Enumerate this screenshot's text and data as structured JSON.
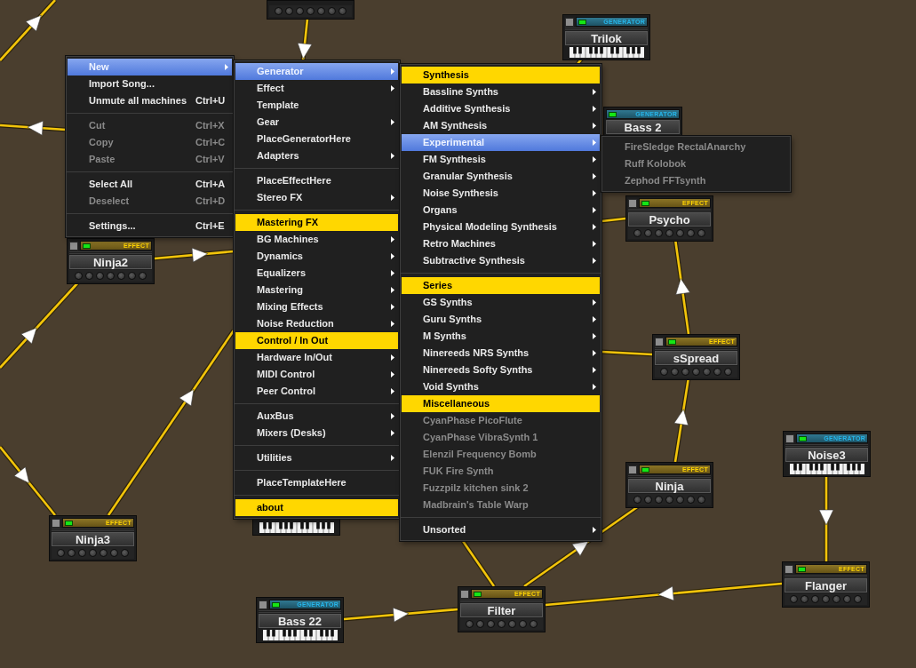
{
  "machines": [
    {
      "kind": "effect"
    },
    {
      "kind": "generator",
      "type_label": "GENERATOR",
      "name": "Trilok"
    },
    {
      "kind": "generator",
      "type_label": "GENERATOR",
      "name": "Bass 2"
    },
    {
      "kind": "effect",
      "type_label": "EFFECT",
      "name": "Psycho"
    },
    {
      "kind": "effect",
      "type_label": "EFFECT",
      "name": "Ninja2"
    },
    {
      "kind": "effect",
      "type_label": "EFFECT",
      "name": "sSpread"
    },
    {
      "kind": "generator",
      "type_label": "GENERATOR",
      "name": "Noise3"
    },
    {
      "kind": "effect",
      "type_label": "EFFECT",
      "name": "Ninja"
    },
    {
      "kind": "effect",
      "type_label": "EFFECT",
      "name": "Ninja3"
    },
    {
      "kind": "generator"
    },
    {
      "kind": "effect",
      "type_label": "EFFECT",
      "name": "Flanger"
    },
    {
      "kind": "effect",
      "type_label": "EFFECT",
      "name": "Filter"
    },
    {
      "kind": "generator",
      "type_label": "GENERATOR",
      "name": "Bass 22"
    }
  ],
  "context_menu": {
    "items": [
      {
        "kind": "submenu",
        "label": "New",
        "selected": true,
        "disabled": false
      },
      {
        "kind": "command",
        "label": "Import Song...",
        "selected": false,
        "disabled": false
      },
      {
        "kind": "command",
        "label": "Unmute all machines",
        "shortcut": "Ctrl+U",
        "selected": false,
        "disabled": false
      },
      {
        "kind": "separator"
      },
      {
        "kind": "command",
        "label": "Cut",
        "shortcut": "Ctrl+X",
        "selected": false,
        "disabled": true
      },
      {
        "kind": "command",
        "label": "Copy",
        "shortcut": "Ctrl+C",
        "selected": false,
        "disabled": true
      },
      {
        "kind": "command",
        "label": "Paste",
        "shortcut": "Ctrl+V",
        "selected": false,
        "disabled": true
      },
      {
        "kind": "separator"
      },
      {
        "kind": "command",
        "label": "Select All",
        "shortcut": "Ctrl+A",
        "selected": false,
        "disabled": false
      },
      {
        "kind": "command",
        "label": "Deselect",
        "shortcut": "Ctrl+D",
        "selected": false,
        "disabled": true
      },
      {
        "kind": "separator"
      },
      {
        "kind": "command",
        "label": "Settings...",
        "shortcut": "Ctrl+E",
        "selected": false,
        "disabled": false
      }
    ]
  },
  "submenus": [
    {
      "items": [
        {
          "kind": "submenu",
          "label": "Generator",
          "selected": true,
          "disabled": false
        },
        {
          "kind": "submenu",
          "label": "Effect",
          "selected": false,
          "disabled": false
        },
        {
          "kind": "command",
          "label": "Template",
          "selected": false,
          "disabled": false
        },
        {
          "kind": "submenu",
          "label": "Gear",
          "selected": false,
          "disabled": false
        },
        {
          "kind": "command",
          "label": "PlaceGeneratorHere",
          "selected": false,
          "disabled": false
        },
        {
          "kind": "submenu",
          "label": "Adapters",
          "selected": false,
          "disabled": false
        },
        {
          "kind": "separator"
        },
        {
          "kind": "command",
          "label": "PlaceEffectHere",
          "selected": false,
          "disabled": false
        },
        {
          "kind": "submenu",
          "label": "Stereo FX",
          "selected": false,
          "disabled": false
        },
        {
          "kind": "separator"
        },
        {
          "kind": "header",
          "label": "Mastering FX"
        },
        {
          "kind": "submenu",
          "label": "BG Machines",
          "selected": false,
          "disabled": false
        },
        {
          "kind": "submenu",
          "label": "Dynamics",
          "selected": false,
          "disabled": false
        },
        {
          "kind": "submenu",
          "label": "Equalizers",
          "selected": false,
          "disabled": false
        },
        {
          "kind": "submenu",
          "label": "Mastering",
          "selected": false,
          "disabled": false
        },
        {
          "kind": "submenu",
          "label": "Mixing Effects",
          "selected": false,
          "disabled": false
        },
        {
          "kind": "submenu",
          "label": "Noise Reduction",
          "selected": false,
          "disabled": false
        },
        {
          "kind": "header",
          "label": "Control / In Out"
        },
        {
          "kind": "submenu",
          "label": "Hardware In/Out",
          "selected": false,
          "disabled": false
        },
        {
          "kind": "submenu",
          "label": "MIDI Control",
          "selected": false,
          "disabled": false
        },
        {
          "kind": "submenu",
          "label": "Peer Control",
          "selected": false,
          "disabled": false
        },
        {
          "kind": "separator"
        },
        {
          "kind": "submenu",
          "label": "AuxBus",
          "selected": false,
          "disabled": false
        },
        {
          "kind": "submenu",
          "label": "Mixers (Desks)",
          "selected": false,
          "disabled": false
        },
        {
          "kind": "separator"
        },
        {
          "kind": "submenu",
          "label": "Utilities",
          "selected": false,
          "disabled": false
        },
        {
          "kind": "separator"
        },
        {
          "kind": "command",
          "label": "PlaceTemplateHere",
          "selected": false,
          "disabled": false
        },
        {
          "kind": "separator"
        },
        {
          "kind": "header",
          "label": "about"
        }
      ]
    },
    {
      "items": [
        {
          "kind": "header",
          "label": "Synthesis"
        },
        {
          "kind": "submenu",
          "label": "Bassline Synths",
          "selected": false,
          "disabled": false
        },
        {
          "kind": "submenu",
          "label": "Additive Synthesis",
          "selected": false,
          "disabled": false
        },
        {
          "kind": "submenu",
          "label": "AM Synthesis",
          "selected": false,
          "disabled": false
        },
        {
          "kind": "submenu",
          "label": "Experimental",
          "selected": true,
          "disabled": false
        },
        {
          "kind": "submenu",
          "label": "FM Synthesis",
          "selected": false,
          "disabled": false
        },
        {
          "kind": "submenu",
          "label": "Granular Synthesis",
          "selected": false,
          "disabled": false
        },
        {
          "kind": "submenu",
          "label": "Noise Synthesis",
          "selected": false,
          "disabled": false
        },
        {
          "kind": "submenu",
          "label": "Organs",
          "selected": false,
          "disabled": false
        },
        {
          "kind": "submenu",
          "label": "Physical Modeling Synthesis",
          "selected": false,
          "disabled": false
        },
        {
          "kind": "submenu",
          "label": "Retro Machines",
          "selected": false,
          "disabled": false
        },
        {
          "kind": "submenu",
          "label": "Subtractive Synthesis",
          "selected": false,
          "disabled": false
        },
        {
          "kind": "separator"
        },
        {
          "kind": "header",
          "label": "Series"
        },
        {
          "kind": "submenu",
          "label": "GS Synths",
          "selected": false,
          "disabled": false
        },
        {
          "kind": "submenu",
          "label": "Guru Synths",
          "selected": false,
          "disabled": false
        },
        {
          "kind": "submenu",
          "label": "M Synths",
          "selected": false,
          "disabled": false
        },
        {
          "kind": "submenu",
          "label": "Ninereeds NRS Synths",
          "selected": false,
          "disabled": false
        },
        {
          "kind": "submenu",
          "label": "Ninereeds Softy Synths",
          "selected": false,
          "disabled": false
        },
        {
          "kind": "submenu",
          "label": "Void Synths",
          "selected": false,
          "disabled": false
        },
        {
          "kind": "header",
          "label": "Miscellaneous"
        },
        {
          "kind": "command",
          "label": "CyanPhase PicoFlute",
          "selected": false,
          "disabled": true
        },
        {
          "kind": "command",
          "label": "CyanPhase VibraSynth 1",
          "selected": false,
          "disabled": true
        },
        {
          "kind": "command",
          "label": "Elenzil Frequency Bomb",
          "selected": false,
          "disabled": true
        },
        {
          "kind": "command",
          "label": "FUK Fire Synth",
          "selected": false,
          "disabled": true
        },
        {
          "kind": "command",
          "label": "Fuzzpilz kitchen sink 2",
          "selected": false,
          "disabled": true
        },
        {
          "kind": "command",
          "label": "Madbrain's Table Warp",
          "selected": false,
          "disabled": true
        },
        {
          "kind": "separator"
        },
        {
          "kind": "submenu",
          "label": "Unsorted",
          "selected": false,
          "disabled": false
        }
      ]
    },
    {
      "items": [
        {
          "kind": "command",
          "label": "FireSledge RectalAnarchy",
          "selected": false,
          "disabled": true
        },
        {
          "kind": "command",
          "label": "Ruff Kolobok",
          "selected": false,
          "disabled": true
        },
        {
          "kind": "command",
          "label": "Zephod FFTsynth",
          "selected": false,
          "disabled": true
        }
      ]
    }
  ]
}
